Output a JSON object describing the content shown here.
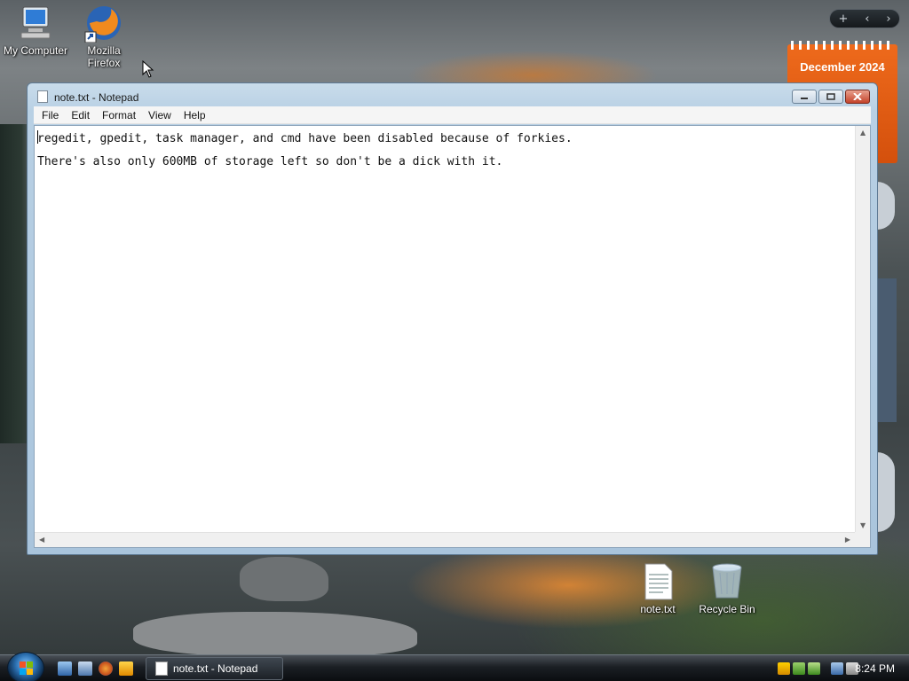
{
  "desktop": {
    "icons": [
      {
        "label": "My Computer",
        "icon": "computer-icon"
      },
      {
        "label": "Mozilla\nFirefox",
        "icon": "firefox-icon"
      },
      {
        "label": "note.txt",
        "icon": "text-file-icon"
      },
      {
        "label": "Recycle Bin",
        "icon": "recycle-bin-icon"
      }
    ],
    "calendar_gadget": {
      "label": "December 2024"
    }
  },
  "notepad": {
    "title": "note.txt - Notepad",
    "menu": [
      "File",
      "Edit",
      "Format",
      "View",
      "Help"
    ],
    "lines": [
      "regedit, gpedit, task manager, and cmd have been disabled because of forkies.",
      "There's also only 600MB of storage left so don't be a dick with it."
    ]
  },
  "taskbar": {
    "window_button": "note.txt - Notepad",
    "clock": "8:24 PM"
  },
  "colors": {
    "calendar": "#e35f14",
    "titlebar": "#b8d0e4",
    "close_button": "#c4432a"
  }
}
